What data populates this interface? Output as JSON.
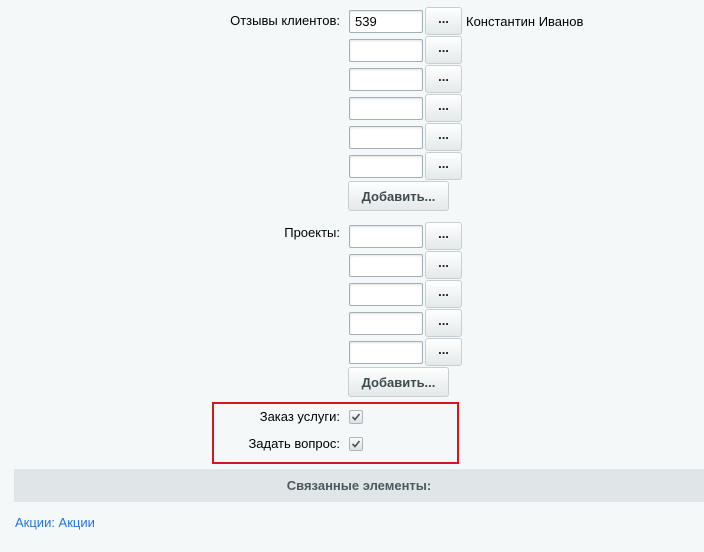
{
  "reviews": {
    "label": "Отзывы клиентов:",
    "rows": [
      {
        "value": "539",
        "button": "...",
        "name": "Константин Иванов"
      },
      {
        "value": "",
        "button": "..."
      },
      {
        "value": "",
        "button": "..."
      },
      {
        "value": "",
        "button": "..."
      },
      {
        "value": "",
        "button": "..."
      },
      {
        "value": "",
        "button": "..."
      }
    ],
    "add_label": "Добавить..."
  },
  "projects": {
    "label": "Проекты:",
    "rows": [
      {
        "value": "",
        "button": "..."
      },
      {
        "value": "",
        "button": "..."
      },
      {
        "value": "",
        "button": "..."
      },
      {
        "value": "",
        "button": "..."
      },
      {
        "value": "",
        "button": "..."
      }
    ],
    "add_label": "Добавить..."
  },
  "options": {
    "order_service": {
      "label": "Заказ услуги:",
      "checked": true
    },
    "ask_question": {
      "label": "Задать вопрос:",
      "checked": true
    }
  },
  "related": {
    "section_title": "Связанные элементы:",
    "link_label": "Акции: Акции"
  },
  "colors": {
    "highlight_border": "#d2161d",
    "link": "#2675d7",
    "section_bg": "#e0e6e8"
  }
}
